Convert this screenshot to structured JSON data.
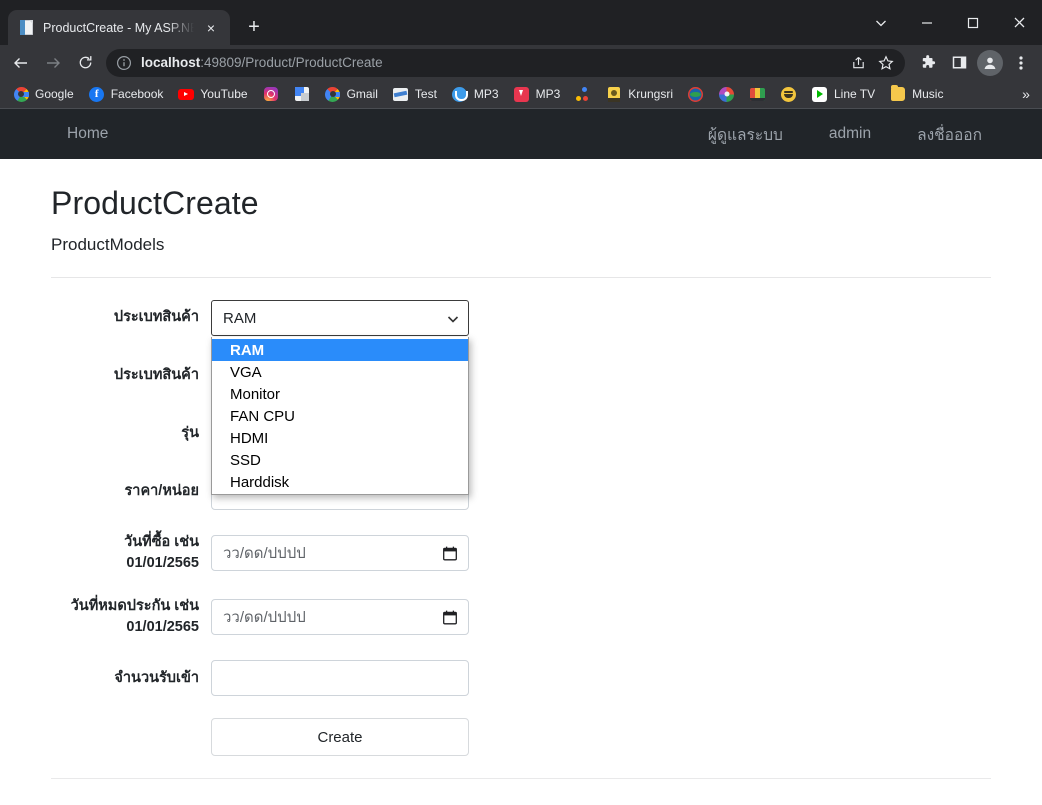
{
  "browser": {
    "tab": {
      "title": "ProductCreate - My ASP.NET App",
      "favicon": "document-icon",
      "close": "×"
    },
    "newtab_label": "+",
    "window_controls": {
      "tab_search": "tab-search-chevron",
      "minimize": "–",
      "maximize": "□",
      "close": "×"
    },
    "toolbar": {
      "back": "back-arrow-icon",
      "forward": "forward-arrow-icon",
      "reload": "reload-icon",
      "site_info": "info-circle-icon",
      "url_host": "localhost",
      "url_rest": ":49809/Product/ProductCreate",
      "url_full": "localhost:49809/Product/ProductCreate",
      "share": "share-icon",
      "bookmark": "star-icon",
      "extensions": "puzzle-icon",
      "side_panel": "side-panel-icon",
      "profile": "profile-avatar-icon",
      "menu": "three-dot-menu-icon"
    },
    "bookmarks": [
      {
        "label": "Google",
        "icon": "google-icon"
      },
      {
        "label": "Facebook",
        "icon": "facebook-icon"
      },
      {
        "label": "YouTube",
        "icon": "youtube-icon"
      },
      {
        "label": "",
        "icon": "instagram-icon"
      },
      {
        "label": "",
        "icon": "google-translate-icon"
      },
      {
        "label": "Gmail",
        "icon": "google-icon"
      },
      {
        "label": "Test",
        "icon": "test-icon"
      },
      {
        "label": "MP3",
        "icon": "mp3-blue-icon"
      },
      {
        "label": "MP3",
        "icon": "mp3-red-icon"
      },
      {
        "label": "",
        "icon": "dots-icon"
      },
      {
        "label": "Krungsri",
        "icon": "krungsri-icon"
      },
      {
        "label": "",
        "icon": "globe-icon"
      },
      {
        "label": "",
        "icon": "paint-icon"
      },
      {
        "label": "",
        "icon": "tent-icon"
      },
      {
        "label": "",
        "icon": "smiley-icon"
      },
      {
        "label": "Line TV",
        "icon": "linetv-icon"
      },
      {
        "label": "Music",
        "icon": "folder-music-icon"
      }
    ],
    "bookmarks_overflow": "»"
  },
  "site": {
    "navbar": {
      "brand": "Home",
      "right_links": [
        "ผู้ดูแลระบบ",
        "admin",
        "ลงชื่อออก"
      ]
    },
    "page_title": "ProductCreate",
    "page_subtitle": "ProductModels",
    "form": {
      "rows": [
        {
          "label": "ประเบทสินค้า",
          "type": "select",
          "value": "RAM"
        },
        {
          "label": "ประเบทสินค้า",
          "type": "text",
          "value": ""
        },
        {
          "label": "รุ่น",
          "type": "text",
          "value": ""
        },
        {
          "label": "ราคา/หน่อย",
          "type": "text",
          "value": ""
        },
        {
          "label": "วันที่ซื้อ เช่น 01/01/2565",
          "type": "date",
          "placeholder": "วว/ดด/ปปปป"
        },
        {
          "label": "วันที่หมดประกัน เช่น 01/01/2565",
          "type": "date",
          "placeholder": "วว/ดด/ปปปป"
        },
        {
          "label": "จำนวนรับเข้า",
          "type": "text",
          "value": ""
        }
      ],
      "submit_label": "Create",
      "dropdown": {
        "open": true,
        "selected": "RAM",
        "options": [
          "RAM",
          "VGA",
          "Monitor",
          "FAN CPU",
          "HDMI",
          "SSD",
          "Harddisk"
        ]
      }
    }
  },
  "colors": {
    "chrome_dark": "#202124",
    "chrome_toolbar": "#35363a",
    "navbar_dark": "#212529",
    "dropdown_highlight": "#2a8cfa",
    "page_bg": "#ffffff"
  }
}
